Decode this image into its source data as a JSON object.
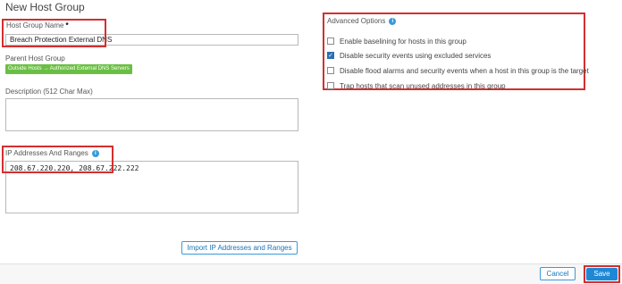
{
  "page": {
    "title": "New Host Group"
  },
  "host_group_name": {
    "label": "Host Group Name",
    "required_mark": "*",
    "value": "Breach Protection External DNS"
  },
  "parent_host_group": {
    "label": "Parent Host Group",
    "value": "Outside Hosts → Authorized External DNS Servers"
  },
  "description": {
    "label": "Description (512 Char Max)",
    "value": ""
  },
  "ip_ranges": {
    "label": "IP Addresses And Ranges",
    "info_icon": "i",
    "value": "208.67.220.220, 208.67.222.222"
  },
  "import_button": {
    "label": "Import IP Addresses and Ranges"
  },
  "advanced_options": {
    "label": "Advanced Options",
    "info_icon": "i",
    "items": [
      {
        "label": "Enable baselining for hosts in this group",
        "checked": false
      },
      {
        "label": "Disable security events using excluded services",
        "checked": true
      },
      {
        "label": "Disable flood alarms and security events when a host in this group is the target",
        "checked": false
      },
      {
        "label": "Trap hosts that scan unused addresses in this group",
        "checked": false
      }
    ]
  },
  "footer": {
    "cancel_label": "Cancel",
    "save_label": "Save"
  },
  "colors": {
    "highlight": "#d32f2f",
    "accent": "#1e88d6",
    "badge": "#6abf43"
  }
}
